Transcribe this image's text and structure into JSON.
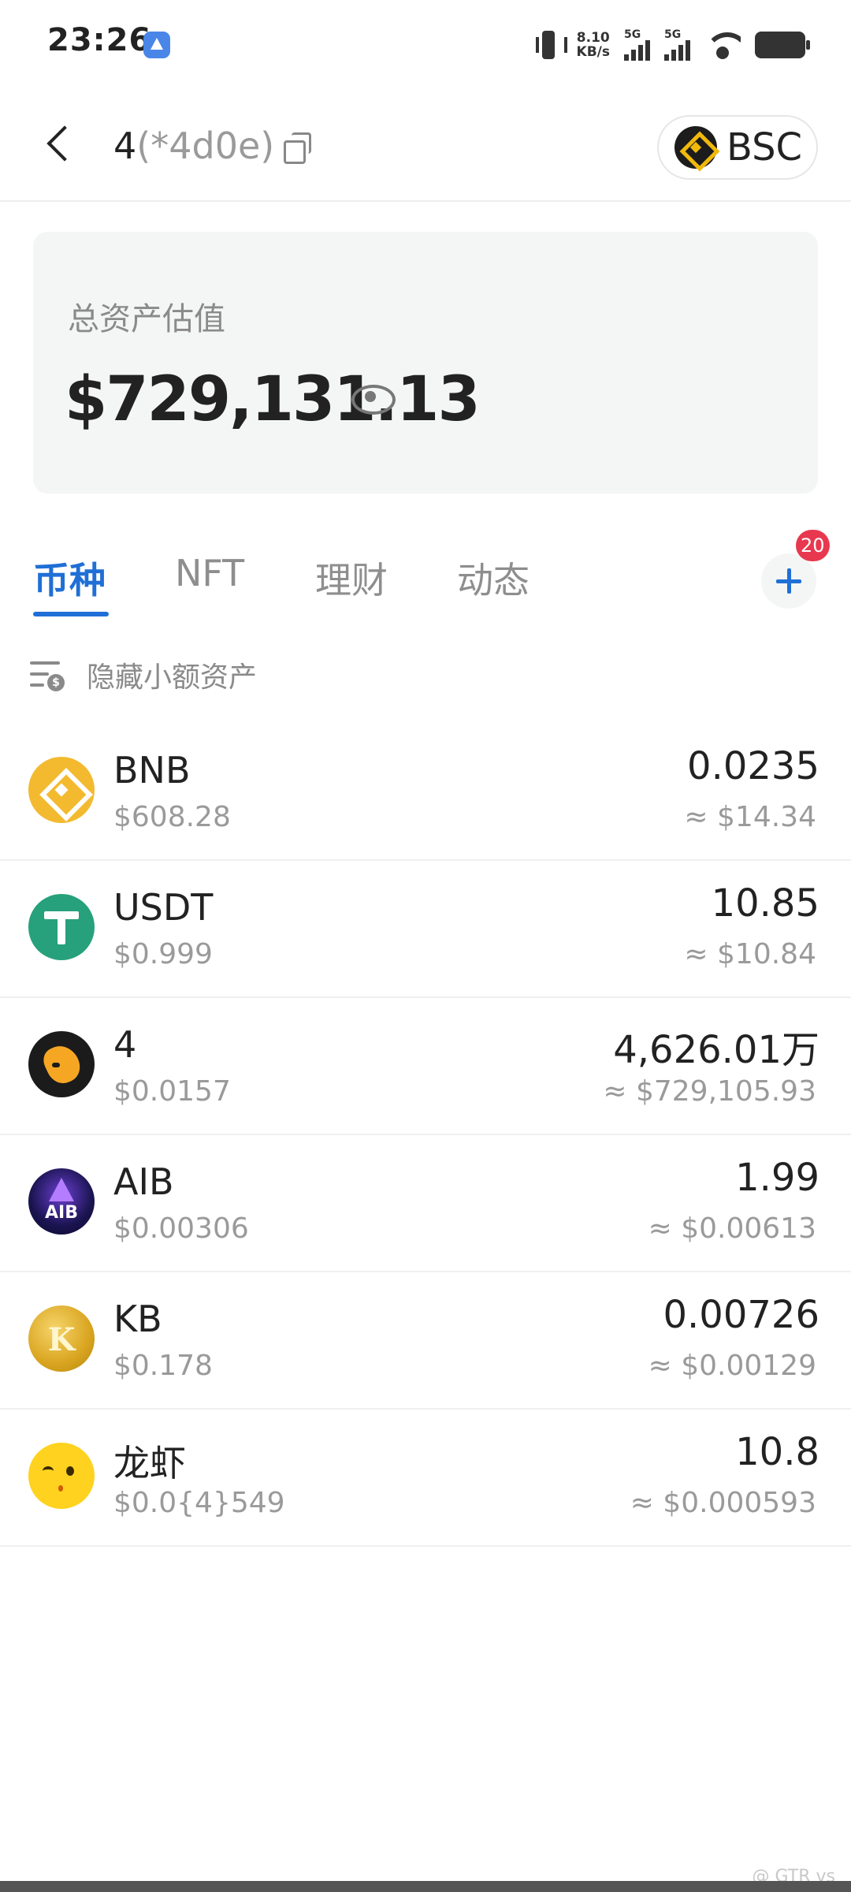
{
  "status_bar": {
    "time": "23:26",
    "speed_value": "8.10",
    "speed_unit": "KB/s",
    "sim1_label": "5G",
    "sim2_label": "5G"
  },
  "header": {
    "wallet_name": "4",
    "wallet_address_short": "(*4d0e)",
    "chain_label": "BSC"
  },
  "asset_card": {
    "label": "总资产估值",
    "total_value": "$729,131.13"
  },
  "tabs": [
    {
      "label": "币种",
      "active": true
    },
    {
      "label": "NFT",
      "active": false
    },
    {
      "label": "理财",
      "active": false
    },
    {
      "label": "动态",
      "active": false
    }
  ],
  "add_badge_count": "20",
  "hide_small_label": "隐藏小额资产",
  "tokens": [
    {
      "name": "BNB",
      "price": "$608.28",
      "amount": "0.0235",
      "fiat": "≈ $14.34",
      "icon": "bnb-icon"
    },
    {
      "name": "USDT",
      "price": "$0.999",
      "amount": "10.85",
      "fiat": "≈ $10.84",
      "icon": "usdt-icon"
    },
    {
      "name": "4",
      "price": "$0.0157",
      "amount": "4,626.01万",
      "fiat": "≈ $729,105.93",
      "icon": "four-token-icon"
    },
    {
      "name": "AIB",
      "price": "$0.00306",
      "amount": "1.99",
      "fiat": "≈ $0.00613",
      "icon": "aib-icon"
    },
    {
      "name": "KB",
      "price": "$0.178",
      "amount": "0.00726",
      "fiat": "≈ $0.00129",
      "icon": "kb-icon"
    },
    {
      "name": "龙虾",
      "price": "$0.0{4}549",
      "amount": "10.8",
      "fiat": "≈ $0.000593",
      "icon": "longxia-icon"
    }
  ],
  "icons": {
    "aib_text": "AIB",
    "kb_text": "K"
  },
  "watermark": "@ GTR vs",
  "colors": {
    "accent": "#1f6fd6",
    "badge": "#e8384f",
    "bnb": "#f3ba2f",
    "usdt": "#26a17b"
  }
}
